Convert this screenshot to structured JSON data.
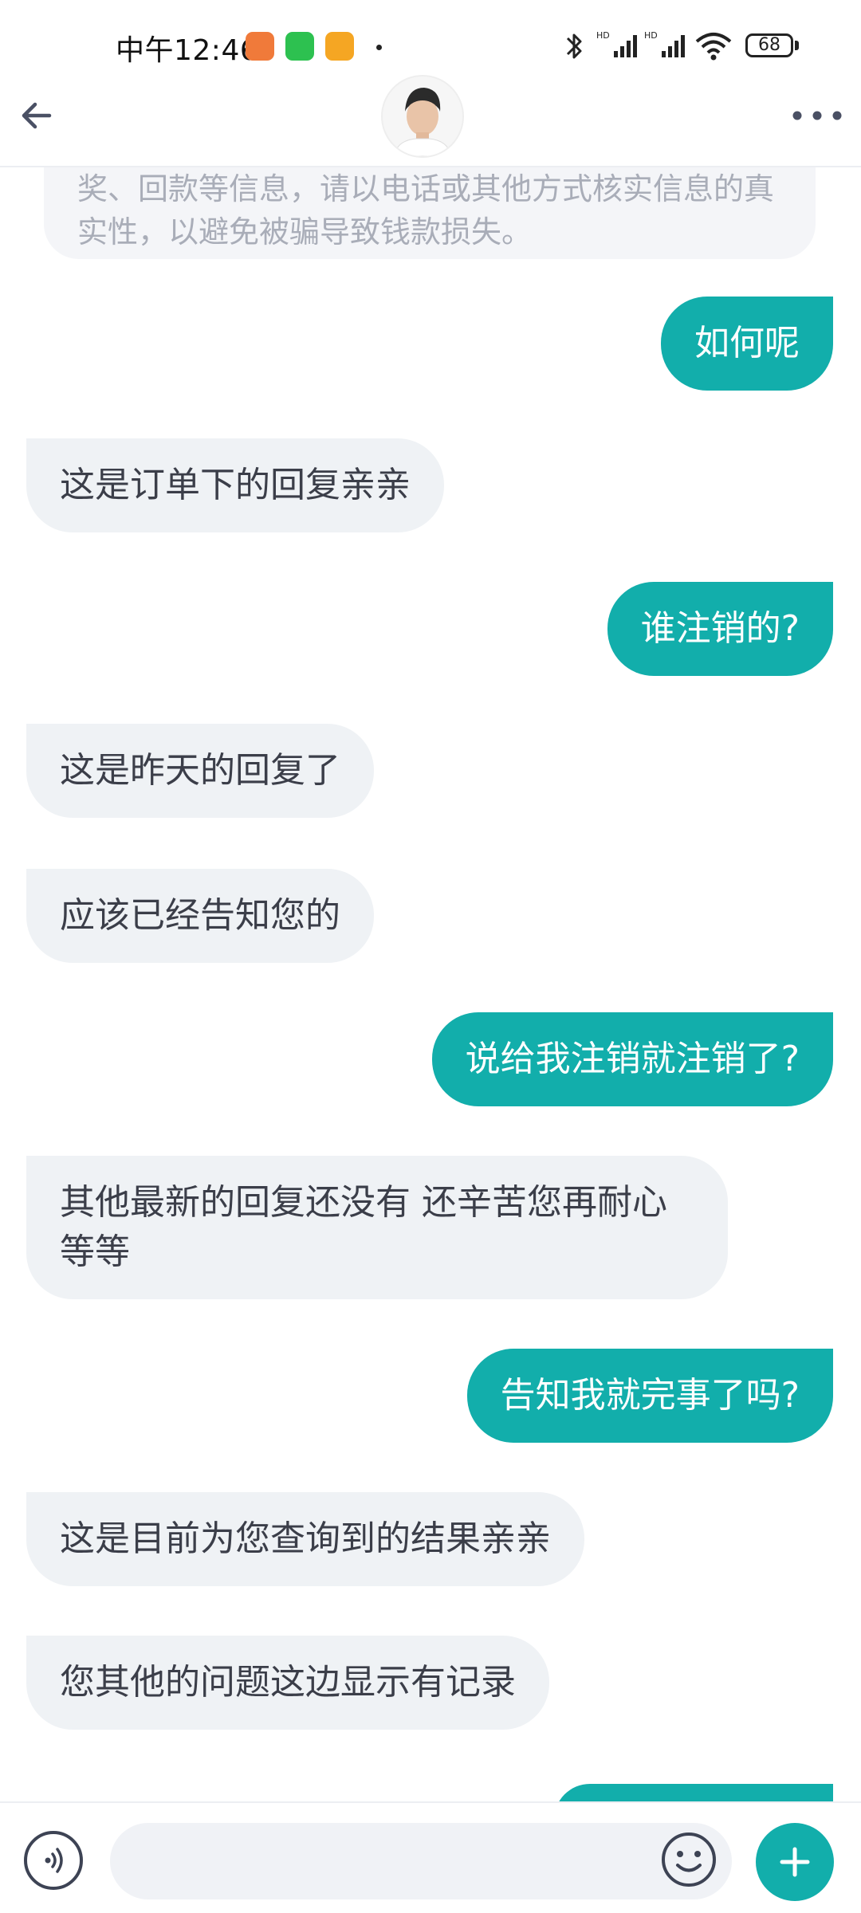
{
  "status_bar": {
    "time": "中午12:46",
    "battery": "68"
  },
  "header": {
    "avatar_label": "客服头像"
  },
  "notice": {
    "text": "奖、回款等信息，请以电话或其他方式核实信息的真实性，以避免被骗导致钱款损失。"
  },
  "messages": [
    {
      "side": "out",
      "text": "如何呢"
    },
    {
      "side": "in",
      "text": "这是订单下的回复亲亲"
    },
    {
      "side": "out",
      "text": "谁注销的?"
    },
    {
      "side": "in",
      "text": "这是昨天的回复了"
    },
    {
      "side": "in",
      "text": "应该已经告知您的"
    },
    {
      "side": "out",
      "text": "说给我注销就注销了?"
    },
    {
      "side": "in",
      "text": "其他最新的回复还没有 还辛苦您再耐心等等"
    },
    {
      "side": "out",
      "text": "告知我就完事了吗?"
    },
    {
      "side": "in",
      "text": "这是目前为您查询到的结果亲亲"
    },
    {
      "side": "in",
      "text": "您其他的问题这边显示有记录"
    }
  ],
  "input": {
    "placeholder": ""
  },
  "colors": {
    "accent": "#12aeab",
    "incoming_bubble": "#eff2f5",
    "incoming_text": "#3b3e49",
    "notice_text": "#a9adb8"
  }
}
